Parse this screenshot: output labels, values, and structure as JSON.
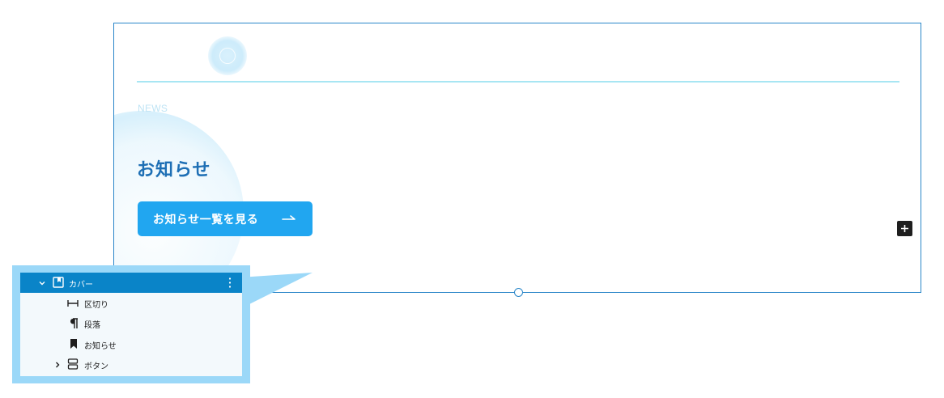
{
  "cover": {
    "eyebrow": "NEWS",
    "heading": "お知らせ",
    "cta_label": "お知らせ一覧を見る",
    "cta_icon": "arrow-right-icon",
    "add_block_icon": "plus-icon"
  },
  "list_view": {
    "items": [
      {
        "label": "カバー",
        "icon": "cover-block-icon",
        "expanded": true,
        "selected": true,
        "more_icon": "more-vertical-icon"
      },
      {
        "label": "区切り",
        "icon": "separator-icon"
      },
      {
        "label": "段落",
        "icon": "paragraph-icon"
      },
      {
        "label": "お知らせ",
        "icon": "bookmark-icon"
      },
      {
        "label": "ボタン",
        "icon": "buttons-icon",
        "expanded": false
      }
    ]
  },
  "colors": {
    "selection_outline": "#2a86c9",
    "heading": "#1e6fb5",
    "cta_background": "#21a6f0",
    "list_selected": "#0a84c8",
    "callout": "#9bd8f8"
  }
}
